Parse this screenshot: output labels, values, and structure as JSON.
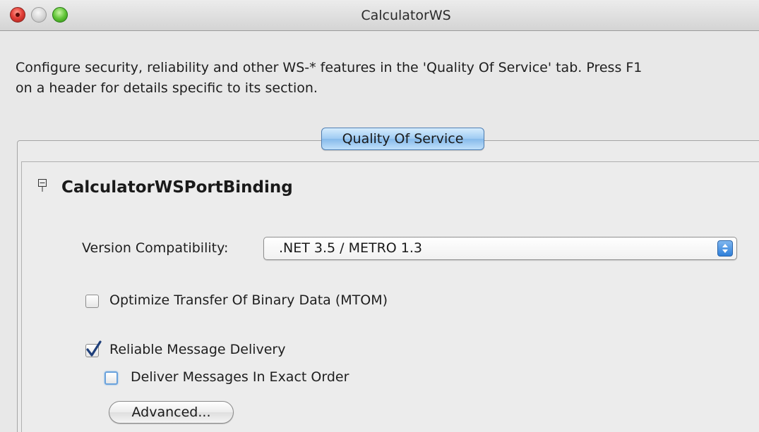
{
  "window": {
    "title": "CalculatorWS"
  },
  "intro": {
    "text": "Configure security, reliability and other WS-* features in the 'Quality Of Service' tab. Press F1\non a header for details specific to its section."
  },
  "tabs": [
    {
      "label": "Quality Of Service",
      "selected": true
    }
  ],
  "section": {
    "title": "CalculatorWSPortBinding",
    "expanded": true
  },
  "version": {
    "label": "Version Compatibility:",
    "selected": ".NET 3.5 / METRO 1.3"
  },
  "options": {
    "mtom": {
      "label": "Optimize Transfer Of Binary Data (MTOM)",
      "checked": false
    },
    "reliable": {
      "label": "Reliable Message Delivery",
      "checked": true
    },
    "exact_order": {
      "label": "Deliver Messages In Exact Order",
      "checked": false
    }
  },
  "buttons": {
    "advanced": "Advanced..."
  },
  "colors": {
    "accent": "#4f8fdc",
    "close": "#e4413a",
    "zoom": "#5fc436"
  }
}
